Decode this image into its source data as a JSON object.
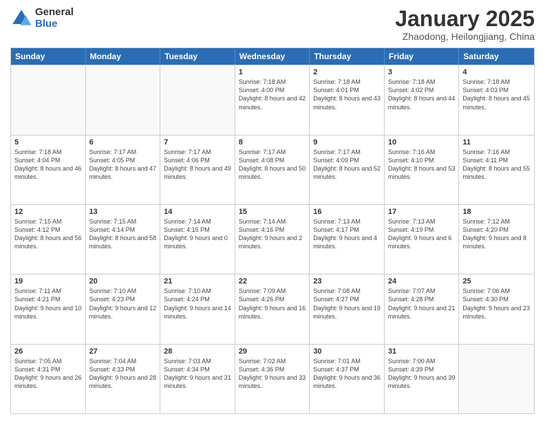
{
  "header": {
    "logo_general": "General",
    "logo_blue": "Blue",
    "month_title": "January 2025",
    "subtitle": "Zhaodong, Heilongjiang, China"
  },
  "days_of_week": [
    "Sunday",
    "Monday",
    "Tuesday",
    "Wednesday",
    "Thursday",
    "Friday",
    "Saturday"
  ],
  "weeks": [
    [
      {
        "day": "",
        "empty": true
      },
      {
        "day": "",
        "empty": true
      },
      {
        "day": "",
        "empty": true
      },
      {
        "day": "1",
        "sunrise": "7:18 AM",
        "sunset": "4:00 PM",
        "daylight": "8 hours and 42 minutes."
      },
      {
        "day": "2",
        "sunrise": "7:18 AM",
        "sunset": "4:01 PM",
        "daylight": "8 hours and 43 minutes."
      },
      {
        "day": "3",
        "sunrise": "7:18 AM",
        "sunset": "4:02 PM",
        "daylight": "8 hours and 44 minutes."
      },
      {
        "day": "4",
        "sunrise": "7:18 AM",
        "sunset": "4:03 PM",
        "daylight": "8 hours and 45 minutes."
      }
    ],
    [
      {
        "day": "5",
        "sunrise": "7:18 AM",
        "sunset": "4:04 PM",
        "daylight": "8 hours and 46 minutes."
      },
      {
        "day": "6",
        "sunrise": "7:17 AM",
        "sunset": "4:05 PM",
        "daylight": "8 hours and 47 minutes."
      },
      {
        "day": "7",
        "sunrise": "7:17 AM",
        "sunset": "4:06 PM",
        "daylight": "8 hours and 49 minutes."
      },
      {
        "day": "8",
        "sunrise": "7:17 AM",
        "sunset": "4:08 PM",
        "daylight": "8 hours and 50 minutes."
      },
      {
        "day": "9",
        "sunrise": "7:17 AM",
        "sunset": "4:09 PM",
        "daylight": "8 hours and 52 minutes."
      },
      {
        "day": "10",
        "sunrise": "7:16 AM",
        "sunset": "4:10 PM",
        "daylight": "8 hours and 53 minutes."
      },
      {
        "day": "11",
        "sunrise": "7:16 AM",
        "sunset": "4:11 PM",
        "daylight": "8 hours and 55 minutes."
      }
    ],
    [
      {
        "day": "12",
        "sunrise": "7:15 AM",
        "sunset": "4:12 PM",
        "daylight": "8 hours and 56 minutes."
      },
      {
        "day": "13",
        "sunrise": "7:15 AM",
        "sunset": "4:14 PM",
        "daylight": "8 hours and 58 minutes."
      },
      {
        "day": "14",
        "sunrise": "7:14 AM",
        "sunset": "4:15 PM",
        "daylight": "9 hours and 0 minutes."
      },
      {
        "day": "15",
        "sunrise": "7:14 AM",
        "sunset": "4:16 PM",
        "daylight": "9 hours and 2 minutes."
      },
      {
        "day": "16",
        "sunrise": "7:13 AM",
        "sunset": "4:17 PM",
        "daylight": "9 hours and 4 minutes."
      },
      {
        "day": "17",
        "sunrise": "7:13 AM",
        "sunset": "4:19 PM",
        "daylight": "9 hours and 6 minutes."
      },
      {
        "day": "18",
        "sunrise": "7:12 AM",
        "sunset": "4:20 PM",
        "daylight": "9 hours and 8 minutes."
      }
    ],
    [
      {
        "day": "19",
        "sunrise": "7:11 AM",
        "sunset": "4:21 PM",
        "daylight": "9 hours and 10 minutes."
      },
      {
        "day": "20",
        "sunrise": "7:10 AM",
        "sunset": "4:23 PM",
        "daylight": "9 hours and 12 minutes."
      },
      {
        "day": "21",
        "sunrise": "7:10 AM",
        "sunset": "4:24 PM",
        "daylight": "9 hours and 14 minutes."
      },
      {
        "day": "22",
        "sunrise": "7:09 AM",
        "sunset": "4:26 PM",
        "daylight": "9 hours and 16 minutes."
      },
      {
        "day": "23",
        "sunrise": "7:08 AM",
        "sunset": "4:27 PM",
        "daylight": "9 hours and 19 minutes."
      },
      {
        "day": "24",
        "sunrise": "7:07 AM",
        "sunset": "4:28 PM",
        "daylight": "9 hours and 21 minutes."
      },
      {
        "day": "25",
        "sunrise": "7:06 AM",
        "sunset": "4:30 PM",
        "daylight": "9 hours and 23 minutes."
      }
    ],
    [
      {
        "day": "26",
        "sunrise": "7:05 AM",
        "sunset": "4:31 PM",
        "daylight": "9 hours and 26 minutes."
      },
      {
        "day": "27",
        "sunrise": "7:04 AM",
        "sunset": "4:33 PM",
        "daylight": "9 hours and 28 minutes."
      },
      {
        "day": "28",
        "sunrise": "7:03 AM",
        "sunset": "4:34 PM",
        "daylight": "9 hours and 31 minutes."
      },
      {
        "day": "29",
        "sunrise": "7:02 AM",
        "sunset": "4:36 PM",
        "daylight": "9 hours and 33 minutes."
      },
      {
        "day": "30",
        "sunrise": "7:01 AM",
        "sunset": "4:37 PM",
        "daylight": "9 hours and 36 minutes."
      },
      {
        "day": "31",
        "sunrise": "7:00 AM",
        "sunset": "4:39 PM",
        "daylight": "9 hours and 39 minutes."
      },
      {
        "day": "",
        "empty": true
      }
    ]
  ]
}
